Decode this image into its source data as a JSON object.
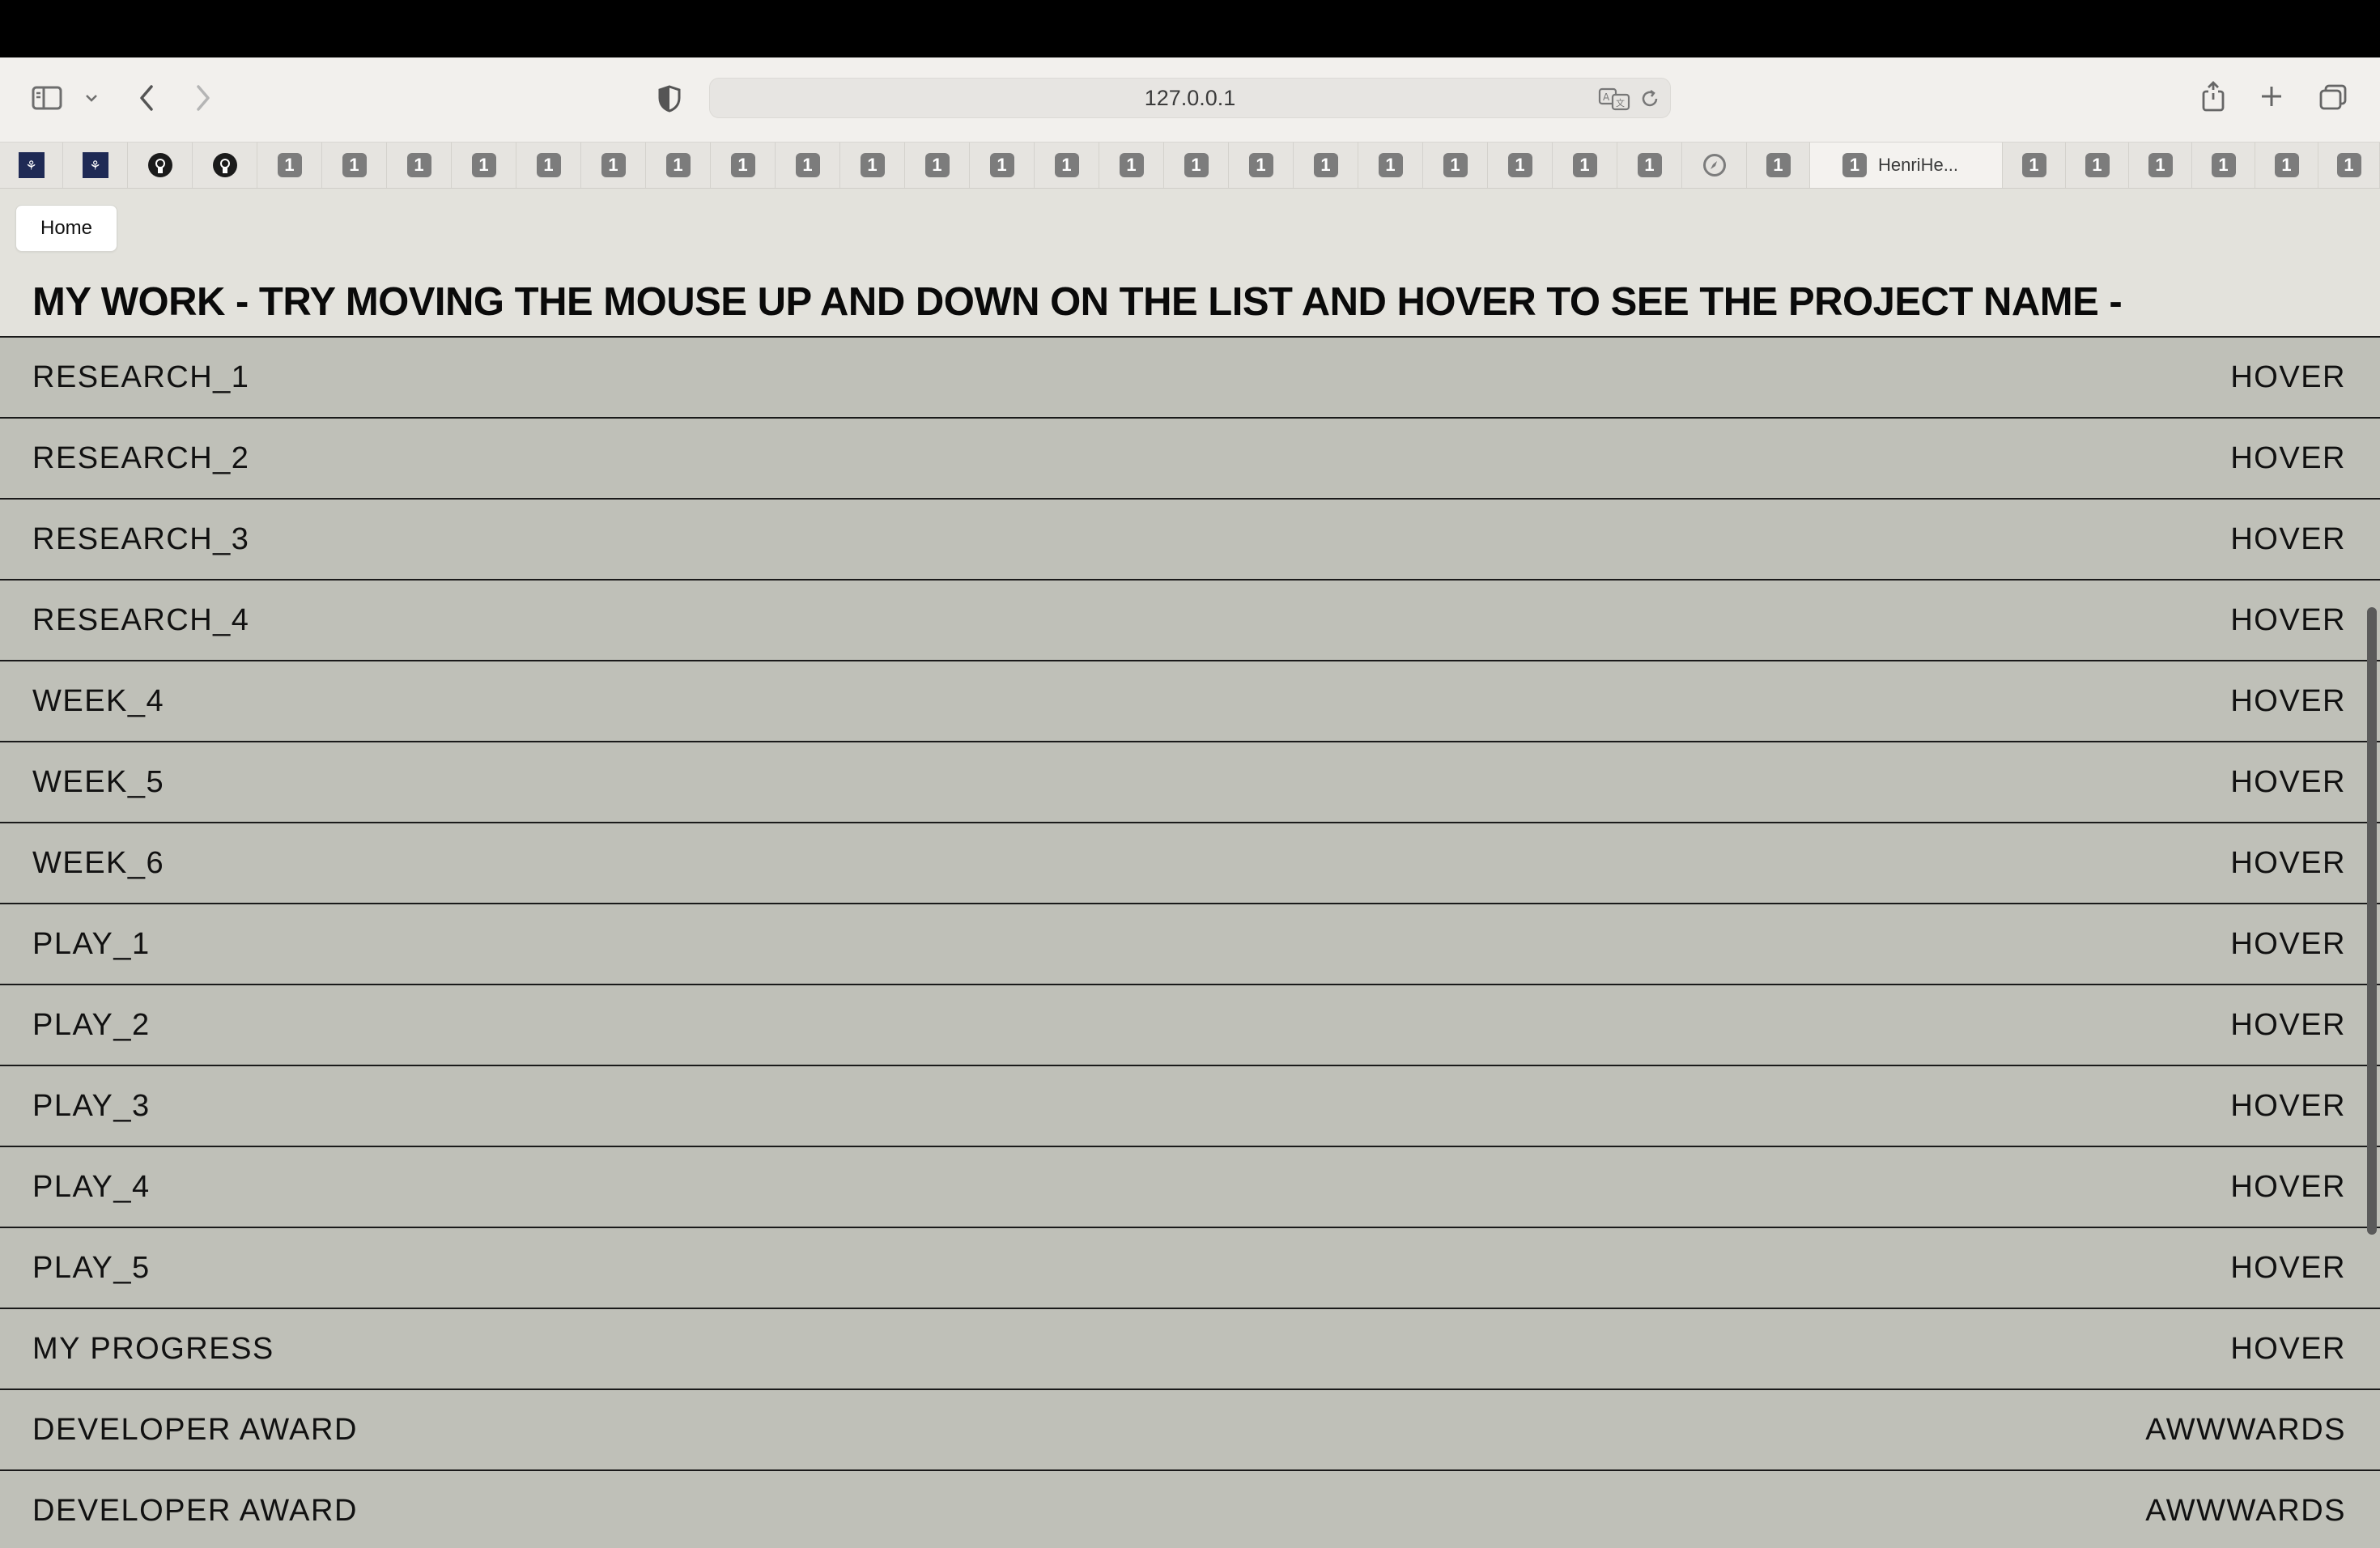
{
  "browser": {
    "url": "127.0.0.1",
    "active_tab_title": "HenriHe...",
    "favicon_badge_text": "1",
    "university_favicon_text": "⚘"
  },
  "page": {
    "home_button": "Home",
    "heading": "MY WORK - TRY MOVING THE MOUSE UP AND DOWN ON THE LIST AND HOVER TO SEE THE PROJECT NAME -",
    "items": [
      {
        "label": "RESEARCH_1",
        "action": "HOVER"
      },
      {
        "label": "RESEARCH_2",
        "action": "HOVER"
      },
      {
        "label": "RESEARCH_3",
        "action": "HOVER"
      },
      {
        "label": "RESEARCH_4",
        "action": "HOVER"
      },
      {
        "label": "WEEK_4",
        "action": "HOVER"
      },
      {
        "label": "WEEK_5",
        "action": "HOVER"
      },
      {
        "label": "WEEK_6",
        "action": "HOVER"
      },
      {
        "label": "PLAY_1",
        "action": "HOVER"
      },
      {
        "label": "PLAY_2",
        "action": "HOVER"
      },
      {
        "label": "PLAY_3",
        "action": "HOVER"
      },
      {
        "label": "PLAY_4",
        "action": "HOVER"
      },
      {
        "label": "PLAY_5",
        "action": "HOVER"
      },
      {
        "label": "MY PROGRESS",
        "action": "HOVER"
      },
      {
        "label": "DEVELOPER AWARD",
        "action": "AWWWARDS"
      },
      {
        "label": "DEVELOPER AWARD",
        "action": "AWWWARDS"
      }
    ]
  },
  "colors": {
    "list_background": "#bfc0b8",
    "page_background": "#e3e2dc",
    "toolbar_background": "#f2f0ed"
  }
}
